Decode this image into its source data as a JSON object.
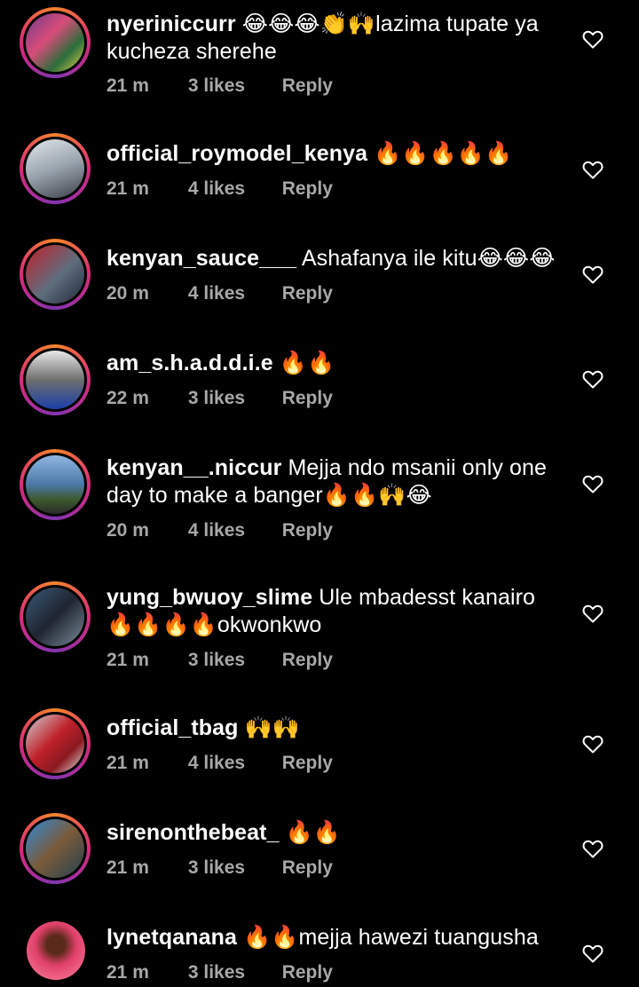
{
  "comments": [
    {
      "username": "nyeriniccurr",
      "text": "😂😂😂👏🙌lazima tupate ya kucheza sherehe",
      "time": "21 m",
      "likes": "3 likes",
      "reply": "Reply"
    },
    {
      "username": "official_roymodel_kenya",
      "text": "🔥🔥🔥🔥🔥",
      "time": "21 m",
      "likes": "4 likes",
      "reply": "Reply"
    },
    {
      "username": "kenyan_sauce___",
      "text": "Ashafanya ile kitu😂😂😂",
      "time": "20 m",
      "likes": "4 likes",
      "reply": "Reply"
    },
    {
      "username": "am_s.h.a.d.d.i.e",
      "text": "🔥🔥",
      "time": "22 m",
      "likes": "3 likes",
      "reply": "Reply"
    },
    {
      "username": "kenyan__.niccur",
      "text": "Mejja ndo msanii only one day to make a banger🔥🔥🙌😂",
      "time": "20 m",
      "likes": "4 likes",
      "reply": "Reply"
    },
    {
      "username": "yung_bwuoy_slime",
      "text": "Ule mbadesst kanairo 🔥🔥🔥🔥okwonkwo",
      "time": "21 m",
      "likes": "3 likes",
      "reply": "Reply"
    },
    {
      "username": "official_tbag",
      "text": "🙌🙌",
      "time": "21 m",
      "likes": "4 likes",
      "reply": "Reply"
    },
    {
      "username": "sirenonthebeat_",
      "text": "🔥🔥",
      "time": "21 m",
      "likes": "3 likes",
      "reply": "Reply"
    },
    {
      "username": "lynetqanana",
      "text": "🔥🔥mejja hawezi tuangusha",
      "time": "21 m",
      "likes": "3 likes",
      "reply": "Reply"
    }
  ],
  "colors": {
    "background": "#000000",
    "text": "#ffffff",
    "meta": "#a8a8a8",
    "ring_start": "#f58529",
    "ring_mid": "#dd2a7b"
  },
  "icons": {
    "like": "heart-outline-icon"
  }
}
